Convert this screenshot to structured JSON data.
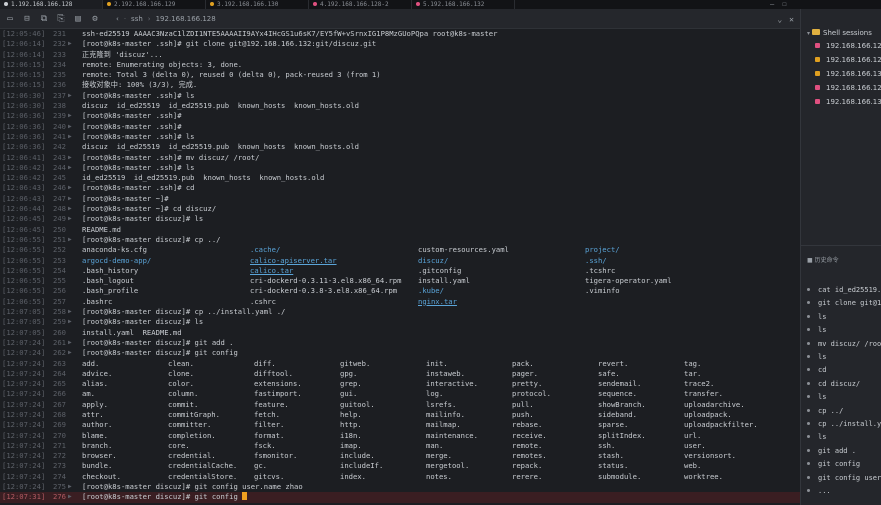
{
  "tabs": [
    {
      "label": "1.192.168.166.128",
      "color": "#c9cdd2",
      "active": true
    },
    {
      "label": "2.192.168.166.129",
      "color": "#e0a020",
      "active": false
    },
    {
      "label": "3.192.168.166.130",
      "color": "#e0a020",
      "active": false
    },
    {
      "label": "4.192.168.166.128-2",
      "color": "#e05080",
      "active": false
    },
    {
      "label": "5.192.168.166.132",
      "color": "#e05080",
      "active": false
    }
  ],
  "address": {
    "proto": "ssh",
    "host": "192.168.166.128"
  },
  "terminal": {
    "lines": [
      {
        "ts": "[12:05:46]",
        "n": "231",
        "t": "ssh-ed25519 AAAAC3NzaC1lZDI1NTE5AAAAII9AYx4IHcGS1u6sK7/EY5fW+vSrnxIG1P8MzGUoPQpa root@k8s-master"
      },
      {
        "ts": "[12:06:14]",
        "n": "232",
        "p": "[root@k8s-master .ssh]# ",
        "t": "git clone git@192.168.166.132:git/discuz.git"
      },
      {
        "ts": "[12:06:14]",
        "n": "233",
        "t": "正克隆到 'discuz'..."
      },
      {
        "ts": "[12:06:15]",
        "n": "234",
        "t": "remote: Enumerating objects: 3, done."
      },
      {
        "ts": "[12:06:15]",
        "n": "235",
        "t": "remote: Total 3 (delta 0), reused 0 (delta 0), pack-reused 3 (from 1)"
      },
      {
        "ts": "[12:06:15]",
        "n": "236",
        "t": "接收对象中: 100% (3/3), 完成."
      },
      {
        "ts": "[12:06:30]",
        "n": "237",
        "p": "[root@k8s-master .ssh]# ",
        "t": "ls"
      },
      {
        "ts": "[12:06:30]",
        "n": "238",
        "t": "discuz  id_ed25519  id_ed25519.pub  known_hosts  known_hosts.old"
      },
      {
        "ts": "[12:06:36]",
        "n": "239",
        "p": "[root@k8s-master .ssh]#",
        "t": ""
      },
      {
        "ts": "[12:06:36]",
        "n": "240",
        "p": "[root@k8s-master .ssh]#",
        "t": ""
      },
      {
        "ts": "[12:06:36]",
        "n": "241",
        "p": "[root@k8s-master .ssh]# ",
        "t": "ls"
      },
      {
        "ts": "[12:06:36]",
        "n": "242",
        "t": "discuz  id_ed25519  id_ed25519.pub  known_hosts  known_hosts.old"
      },
      {
        "ts": "[12:06:41]",
        "n": "243",
        "p": "[root@k8s-master .ssh]# ",
        "t": "mv discuz/ /root/"
      },
      {
        "ts": "[12:06:42]",
        "n": "244",
        "p": "[root@k8s-master .ssh]# ",
        "t": "ls"
      },
      {
        "ts": "[12:06:42]",
        "n": "245",
        "t": "id_ed25519  id_ed25519.pub  known_hosts  known_hosts.old"
      },
      {
        "ts": "[12:06:43]",
        "n": "246",
        "p": "[root@k8s-master .ssh]# ",
        "t": "cd"
      },
      {
        "ts": "[12:06:43]",
        "n": "247",
        "p": "[root@k8s-master ~]#",
        "t": ""
      },
      {
        "ts": "[12:06:44]",
        "n": "248",
        "p": "[root@k8s-master ~]# ",
        "t": "cd discuz/"
      },
      {
        "ts": "[12:06:45]",
        "n": "249",
        "p": "[root@k8s-master discuz]# ",
        "t": "ls"
      },
      {
        "ts": "[12:06:45]",
        "n": "250",
        "t": "README.md"
      },
      {
        "ts": "[12:06:55]",
        "n": "251",
        "p": "[root@k8s-master discuz]# ",
        "t": "cp ../"
      }
    ],
    "cp_listing": [
      {
        "ts": "[12:06:55]",
        "n": "252",
        "c": [
          "anaconda-ks.cfg",
          ".cache/",
          "custom-resources.yaml",
          "project/"
        ]
      },
      {
        "ts": "[12:06:55]",
        "n": "253",
        "c": [
          "argocd-demo-app/",
          "calico-apiserver.tar",
          "discuz/",
          ".ssh/"
        ]
      },
      {
        "ts": "[12:06:55]",
        "n": "254",
        "c": [
          ".bash_history",
          "calico.tar",
          ".gitconfig",
          ".tcshrc"
        ]
      },
      {
        "ts": "[12:06:55]",
        "n": "255",
        "c": [
          ".bash_logout",
          "cri-dockerd-0.3.11-3.el8.x86_64.rpm",
          "install.yaml",
          "tigera-operator.yaml"
        ]
      },
      {
        "ts": "[12:06:55]",
        "n": "256",
        "c": [
          ".bash_profile",
          "cri-dockerd-0.3.8-3.el8.x86_64.rpm",
          ".kube/",
          ".viminfo"
        ]
      },
      {
        "ts": "[12:06:55]",
        "n": "257",
        "c": [
          ".bashrc",
          ".cshrc",
          "nginx.tar",
          ""
        ]
      }
    ],
    "lines2": [
      {
        "ts": "[12:07:05]",
        "n": "258",
        "p": "[root@k8s-master discuz]# ",
        "t": "cp ../install.yaml ./"
      },
      {
        "ts": "[12:07:05]",
        "n": "259",
        "p": "[root@k8s-master discuz]# ",
        "t": "ls"
      },
      {
        "ts": "[12:07:05]",
        "n": "260",
        "t": "install.yaml  README.md"
      },
      {
        "ts": "[12:07:24]",
        "n": "261",
        "p": "[root@k8s-master discuz]# ",
        "t": "git add ."
      },
      {
        "ts": "[12:07:24]",
        "n": "262",
        "p": "[root@k8s-master discuz]# ",
        "t": "git config"
      }
    ],
    "config_listing": [
      {
        "ts": "[12:07:24]",
        "n": "263",
        "c": [
          "add.",
          "clean.",
          "diff.",
          "gitweb.",
          "init.",
          "pack.",
          "revert.",
          "tag."
        ]
      },
      {
        "ts": "[12:07:24]",
        "n": "264",
        "c": [
          "advice.",
          "clone.",
          "difftool.",
          "gpg.",
          "instaweb.",
          "pager.",
          "safe.",
          "tar."
        ]
      },
      {
        "ts": "[12:07:24]",
        "n": "265",
        "c": [
          "alias.",
          "color.",
          "extensions.",
          "grep.",
          "interactive.",
          "pretty.",
          "sendemail.",
          "trace2."
        ]
      },
      {
        "ts": "[12:07:24]",
        "n": "266",
        "c": [
          "am.",
          "column.",
          "fastimport.",
          "gui.",
          "log.",
          "protocol.",
          "sequence.",
          "transfer."
        ]
      },
      {
        "ts": "[12:07:24]",
        "n": "267",
        "c": [
          "apply.",
          "commit.",
          "feature.",
          "guitool.",
          "lsrefs.",
          "pull.",
          "showBranch.",
          "uploadarchive."
        ]
      },
      {
        "ts": "[12:07:24]",
        "n": "268",
        "c": [
          "attr.",
          "commitGraph.",
          "fetch.",
          "help.",
          "mailinfo.",
          "push.",
          "sideband.",
          "uploadpack."
        ]
      },
      {
        "ts": "[12:07:24]",
        "n": "269",
        "c": [
          "author.",
          "committer.",
          "filter.",
          "http.",
          "mailmap.",
          "rebase.",
          "sparse.",
          "uploadpackfilter."
        ]
      },
      {
        "ts": "[12:07:24]",
        "n": "270",
        "c": [
          "blame.",
          "completion.",
          "format.",
          "i18n.",
          "maintenance.",
          "receive.",
          "splitIndex.",
          "url."
        ]
      },
      {
        "ts": "[12:07:24]",
        "n": "271",
        "c": [
          "branch.",
          "core.",
          "fsck.",
          "imap.",
          "man.",
          "remote.",
          "ssh.",
          "user."
        ]
      },
      {
        "ts": "[12:07:24]",
        "n": "272",
        "c": [
          "browser.",
          "credential.",
          "fsmonitor.",
          "include.",
          "merge.",
          "remotes.",
          "stash.",
          "versionsort."
        ]
      },
      {
        "ts": "[12:07:24]",
        "n": "273",
        "c": [
          "bundle.",
          "credentialCache.",
          "gc.",
          "includeIf.",
          "mergetool.",
          "repack.",
          "status.",
          "web."
        ]
      },
      {
        "ts": "[12:07:24]",
        "n": "274",
        "c": [
          "checkout.",
          "credentialStore.",
          "gitcvs.",
          "index.",
          "notes.",
          "rerere.",
          "submodule.",
          "worktree."
        ]
      }
    ],
    "lines3": [
      {
        "ts": "[12:07:24]",
        "n": "275",
        "p": "[root@k8s-master discuz]# ",
        "t": "git config user.name zhao"
      },
      {
        "ts": "[12:07:31]",
        "n": "276",
        "p": "[root@k8s-master discuz]# ",
        "t": "git config "
      }
    ]
  },
  "right_panel": {
    "sessions_title": "Shell sessions",
    "sessions": [
      {
        "label": "192.168.166.128",
        "color": "#e05080"
      },
      {
        "label": "192.168.166.129",
        "color": "#e0a020"
      },
      {
        "label": "192.168.166.130",
        "color": "#e0a020"
      },
      {
        "label": "192.168.166.128",
        "color": "#e05080"
      },
      {
        "label": "192.168.166.132",
        "color": "#e05080"
      }
    ],
    "history_title": "历史命令",
    "history": [
      "cat id_ed25519.pub",
      "git clone git@192.",
      "ls",
      "ls",
      "mv discuz/ /root",
      "ls",
      "cd",
      "cd discuz/",
      "ls",
      "cp ../",
      "cp ../install.yaml",
      "ls",
      "git add .",
      "git config",
      "git config user.name",
      "..."
    ]
  },
  "colors": {
    "accent": "#f0a020",
    "link": "#5aa4d8",
    "prompt_red": "#3a1e22"
  }
}
